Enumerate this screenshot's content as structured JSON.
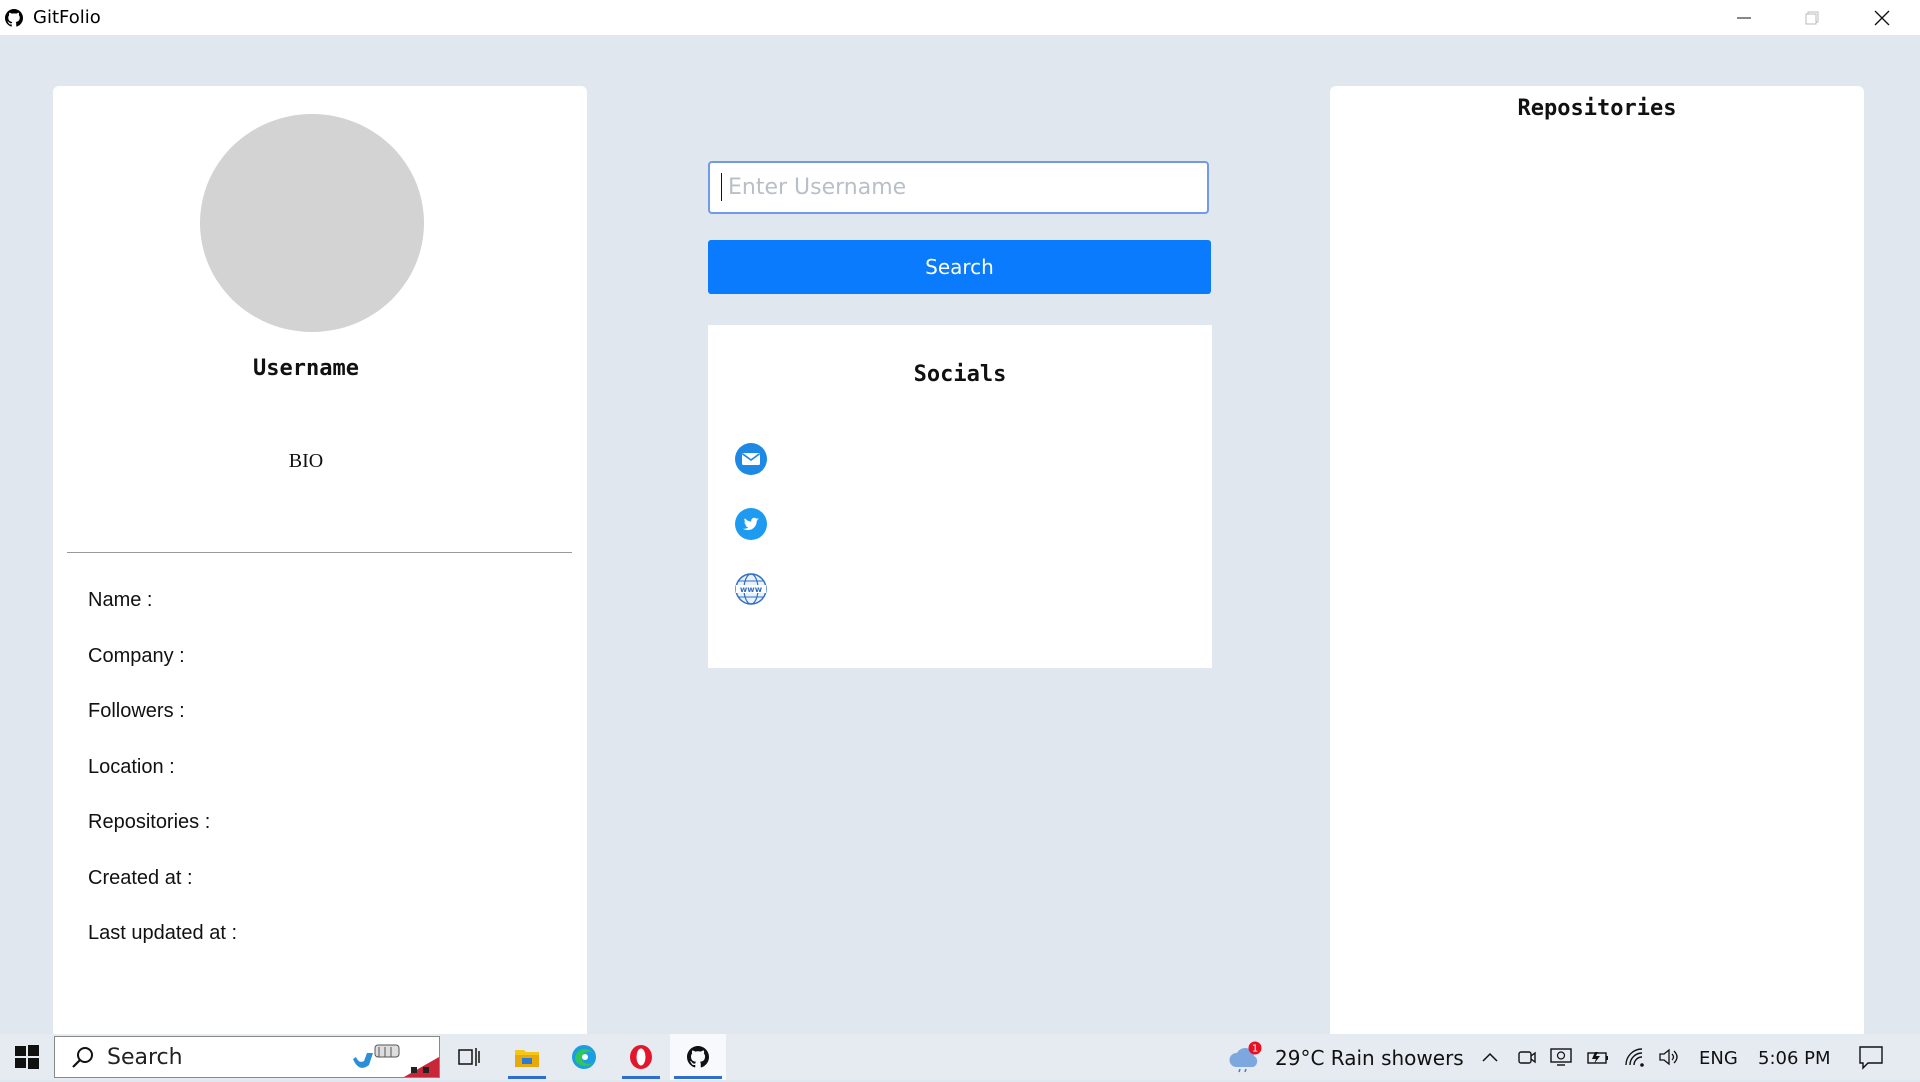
{
  "window": {
    "title": "GitFolio",
    "icon": "github-icon"
  },
  "profile": {
    "username": "Username",
    "bio": "BIO",
    "details": [
      {
        "label": "Name :"
      },
      {
        "label": "Company :"
      },
      {
        "label": "Followers :"
      },
      {
        "label": "Location :"
      },
      {
        "label": "Repositories :"
      },
      {
        "label": "Created at :"
      },
      {
        "label": "Last updated at :"
      }
    ]
  },
  "search": {
    "placeholder": "Enter Username",
    "value": "",
    "button_label": "Search"
  },
  "socials": {
    "title": "Socials",
    "items": [
      {
        "icon": "email-icon"
      },
      {
        "icon": "twitter-icon"
      },
      {
        "icon": "website-www-icon"
      }
    ]
  },
  "repositories": {
    "title": "Repositories"
  },
  "taskbar": {
    "search_label": "Search",
    "weather": "29°C  Rain showers",
    "weather_badge": "1",
    "language": "ENG",
    "time": "5:06 PM",
    "apps": [
      "task-view-icon",
      "file-explorer-icon",
      "edge-icon",
      "opera-icon",
      "github-icon"
    ]
  },
  "colors": {
    "background": "#e1e7ef",
    "accent": "#0a7bfc",
    "input_border": "#6f9be8",
    "avatar": "#d3d3d3"
  }
}
